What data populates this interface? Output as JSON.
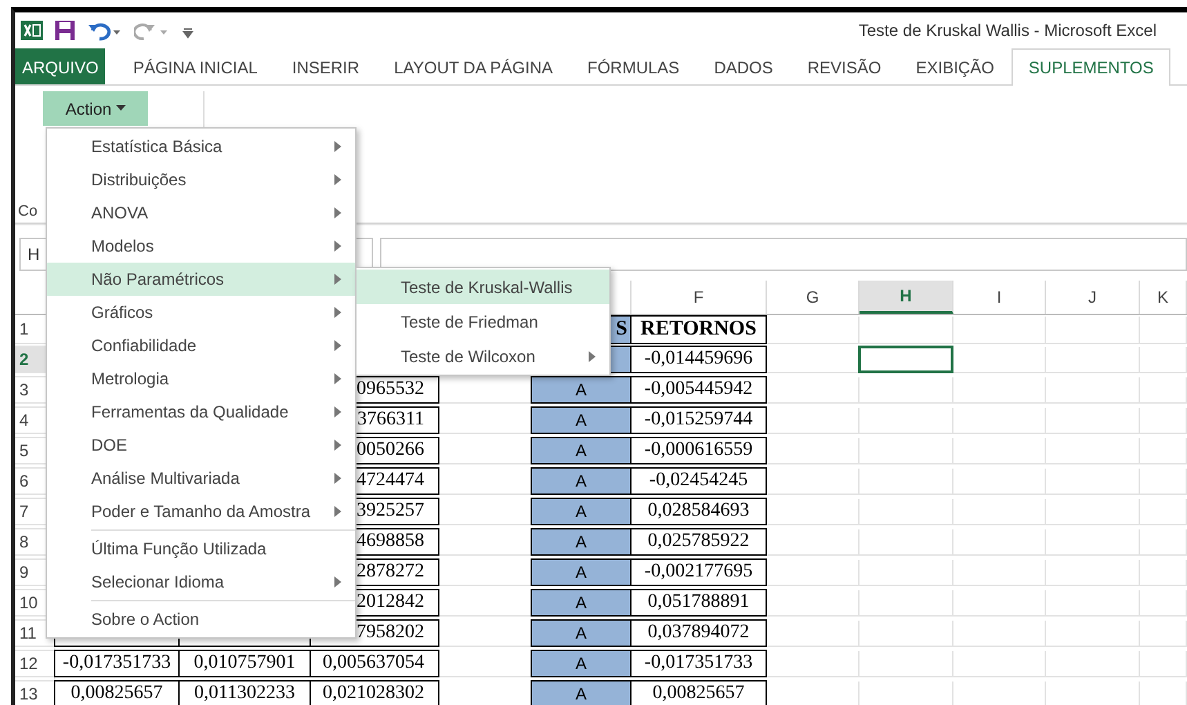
{
  "window": {
    "title": "Teste de Kruskal Wallis - Microsoft Excel"
  },
  "ribbon_tabs": [
    {
      "label": "ARQUIVO",
      "kind": "file",
      "selected": false
    },
    {
      "label": "PÁGINA INICIAL",
      "kind": "tab",
      "selected": false
    },
    {
      "label": "INSERIR",
      "kind": "tab",
      "selected": false
    },
    {
      "label": "LAYOUT DA PÁGINA",
      "kind": "tab",
      "selected": false
    },
    {
      "label": "FÓRMULAS",
      "kind": "tab",
      "selected": false
    },
    {
      "label": "DADOS",
      "kind": "tab",
      "selected": false
    },
    {
      "label": "REVISÃO",
      "kind": "tab",
      "selected": false
    },
    {
      "label": "EXIBIÇÃO",
      "kind": "tab",
      "selected": false
    },
    {
      "label": "SUPLEMENTOS",
      "kind": "tab",
      "selected": true
    }
  ],
  "ribbon": {
    "action_button": "Action",
    "group_label": "Co"
  },
  "name_box": {
    "value": "H"
  },
  "columns": [
    {
      "label": "F",
      "selected": false
    },
    {
      "label": "G",
      "selected": false
    },
    {
      "label": "H",
      "selected": true
    },
    {
      "label": "I",
      "selected": false
    },
    {
      "label": "J",
      "selected": false
    },
    {
      "label": "K",
      "selected": false
    }
  ],
  "rows": [
    {
      "number": "1",
      "kind": "heading",
      "selected": false,
      "cells": {
        "E": "S",
        "F": "RETORNOS"
      }
    },
    {
      "number": "2",
      "kind": "data",
      "selected": true,
      "cells": {
        "F": "-0,014459696"
      }
    },
    {
      "number": "3",
      "kind": "data",
      "selected": false,
      "cells": {
        "C": "0965532",
        "E": "A",
        "F": "-0,005445942"
      }
    },
    {
      "number": "4",
      "kind": "data",
      "selected": false,
      "cells": {
        "C": "3766311",
        "E": "A",
        "F": "-0,015259744"
      }
    },
    {
      "number": "5",
      "kind": "data",
      "selected": false,
      "cells": {
        "C": "0050266",
        "E": "A",
        "F": "-0,000616559"
      }
    },
    {
      "number": "6",
      "kind": "data",
      "selected": false,
      "cells": {
        "C": "4724474",
        "E": "A",
        "F": "-0,02454245"
      }
    },
    {
      "number": "7",
      "kind": "data",
      "selected": false,
      "cells": {
        "C": "3925257",
        "E": "A",
        "F": "0,028584693"
      }
    },
    {
      "number": "8",
      "kind": "data",
      "selected": false,
      "cells": {
        "C": "4698858",
        "E": "A",
        "F": "0,025785922"
      }
    },
    {
      "number": "9",
      "kind": "data",
      "selected": false,
      "cells": {
        "C": "2878272",
        "E": "A",
        "F": "-0,002177695"
      }
    },
    {
      "number": "10",
      "kind": "data",
      "selected": false,
      "cells": {
        "C": "2012842",
        "E": "A",
        "F": "0,051788891"
      }
    },
    {
      "number": "11",
      "kind": "data",
      "selected": false,
      "cells": {
        "C": "7958202",
        "E": "A",
        "F": "0,037894072"
      }
    },
    {
      "number": "12",
      "kind": "data",
      "selected": false,
      "cells": {
        "A": "-0,017351733",
        "B": "0,010757901",
        "C": "0,005637054",
        "E": "A",
        "F": "-0,017351733"
      }
    },
    {
      "number": "13",
      "kind": "data",
      "selected": false,
      "cells": {
        "A": "0,00825657",
        "B": "0,011302233",
        "C": "0,021028302",
        "E": "A",
        "F": "0,00825657"
      }
    }
  ],
  "menu": {
    "items": [
      {
        "kind": "item",
        "label": "Estatística Básica",
        "submenu": true,
        "selected": false
      },
      {
        "kind": "item",
        "label": "Distribuições",
        "submenu": true,
        "selected": false
      },
      {
        "kind": "item",
        "label": "ANOVA",
        "submenu": true,
        "selected": false
      },
      {
        "kind": "item",
        "label": "Modelos",
        "submenu": true,
        "selected": false
      },
      {
        "kind": "item",
        "label": "Não Paramétricos",
        "submenu": true,
        "selected": true
      },
      {
        "kind": "item",
        "label": "Gráficos",
        "submenu": true,
        "selected": false
      },
      {
        "kind": "item",
        "label": "Confiabilidade",
        "submenu": true,
        "selected": false
      },
      {
        "kind": "item",
        "label": "Metrologia",
        "submenu": true,
        "selected": false
      },
      {
        "kind": "item",
        "label": "Ferramentas da Qualidade",
        "submenu": true,
        "selected": false
      },
      {
        "kind": "item",
        "label": "DOE",
        "submenu": true,
        "selected": false
      },
      {
        "kind": "item",
        "label": "Análise Multivariada",
        "submenu": true,
        "selected": false
      },
      {
        "kind": "item",
        "label": "Poder e Tamanho da Amostra",
        "submenu": true,
        "selected": false
      },
      {
        "kind": "separator"
      },
      {
        "kind": "item",
        "label": "Última Função Utilizada",
        "submenu": false,
        "selected": false
      },
      {
        "kind": "item",
        "label": "Selecionar Idioma",
        "submenu": true,
        "selected": false
      },
      {
        "kind": "separator"
      },
      {
        "kind": "item",
        "label": "Sobre o Action",
        "submenu": false,
        "selected": false
      }
    ]
  },
  "submenu": {
    "items": [
      {
        "kind": "item",
        "label": "Teste de Kruskal-Wallis",
        "submenu": false,
        "selected": true
      },
      {
        "kind": "item",
        "label": "Teste de Friedman",
        "submenu": false,
        "selected": false
      },
      {
        "kind": "item",
        "label": "Teste de Wilcoxon",
        "submenu": true,
        "selected": false
      }
    ]
  }
}
